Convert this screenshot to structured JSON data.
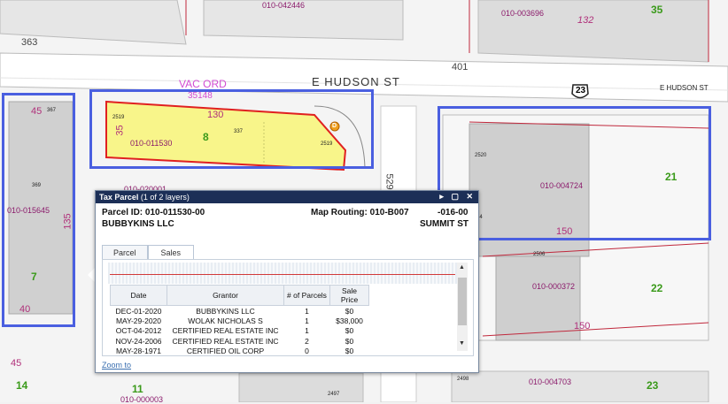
{
  "map": {
    "streets": {
      "main": "E HUDSON ST",
      "small": "E HUDSON ST",
      "route": "23"
    },
    "road_numbers": [
      "363",
      "401",
      "529"
    ],
    "selected_parcel": {
      "id": "010-011530",
      "lot": "8",
      "front": "130",
      "side": "35",
      "marker": "D"
    },
    "vac_ord": {
      "line1": "VAC ORD",
      "line2": "35148"
    },
    "parcel_ids": [
      "010-042446",
      "010-003696",
      "010-015645",
      "010-004724",
      "010-000372",
      "010-004703",
      "010-020001",
      "010-000003"
    ],
    "lot_numbers": [
      "35",
      "21",
      "7",
      "22",
      "23",
      "14",
      "11"
    ],
    "dimensions": [
      "132",
      "45",
      "135",
      "40",
      "45",
      "150",
      "150"
    ],
    "house_numbers": [
      "2519",
      "337",
      "2519",
      "367",
      "369",
      "2520",
      "2506",
      "2497",
      "2498",
      "14"
    ],
    "colors": {
      "selected_fill": "#f8f58a",
      "boundary": "#e02020",
      "selection_box": "#4a5fe0",
      "building": "#cfcfcf"
    }
  },
  "popup": {
    "title": "Tax Parcel",
    "layers_note": "(1 of 2 layers)",
    "controls": "▸ ▢ ✕",
    "parcel_id": "Parcel ID: 010-011530-00",
    "map_routing": "Map Routing: 010-B007",
    "routing_suffix": "-016-00",
    "owner": "BUBBYKINS LLC",
    "street": "SUMMIT ST",
    "tabs": [
      "Parcel",
      "Sales"
    ],
    "active_tab": "Sales",
    "zoom_link": "Zoom to",
    "sales": {
      "columns": [
        "Date",
        "Grantor",
        "# of Parcels",
        "Sale Price"
      ],
      "rows": [
        [
          "DEC-01-2020",
          "BUBBYKINS LLC",
          "1",
          "$0"
        ],
        [
          "MAY-29-2020",
          "WOLAK NICHOLAS S",
          "1",
          "$38,000"
        ],
        [
          "OCT-04-2012",
          "CERTIFIED REAL ESTATE INC",
          "1",
          "$0"
        ],
        [
          "NOV-24-2006",
          "CERTIFIED REAL ESTATE INC",
          "2",
          "$0"
        ],
        [
          "MAY-28-1971",
          "CERTIFIED OIL CORP",
          "0",
          "$0"
        ]
      ]
    }
  }
}
